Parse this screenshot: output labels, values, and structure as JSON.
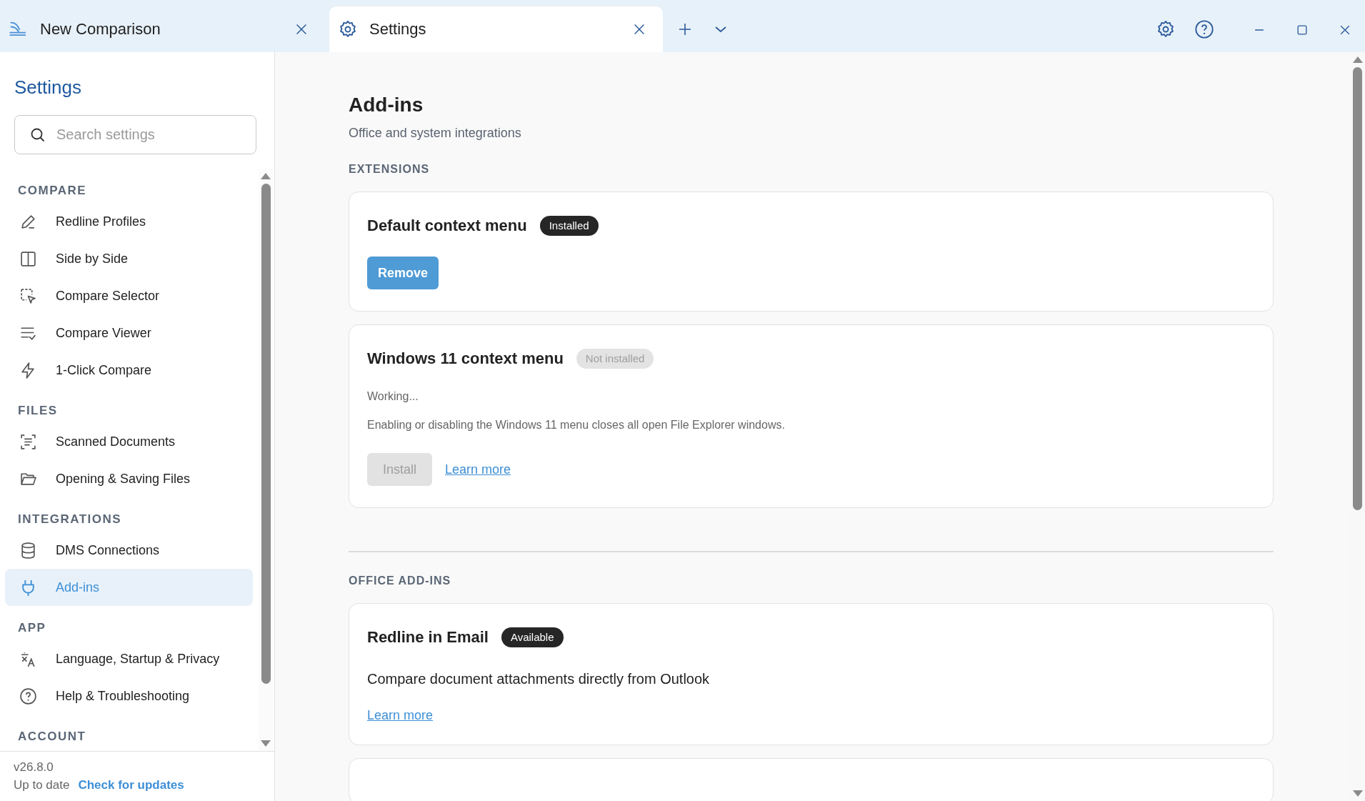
{
  "tabs": [
    {
      "label": "New Comparison",
      "kind": "logo",
      "selected": false
    },
    {
      "label": "Settings",
      "kind": "gear",
      "selected": true
    }
  ],
  "sidebar": {
    "title": "Settings",
    "search": {
      "placeholder": "Search settings"
    },
    "sections": [
      {
        "heading": "COMPARE",
        "items": [
          {
            "label": "Redline Profiles",
            "kind": "pen",
            "selected": false
          },
          {
            "label": "Side by Side",
            "kind": "columns",
            "selected": false
          },
          {
            "label": "Compare Selector",
            "kind": "select",
            "selected": false
          },
          {
            "label": "Compare Viewer",
            "kind": "listcheck",
            "selected": false
          },
          {
            "label": "1-Click Compare",
            "kind": "bolt",
            "selected": false
          }
        ]
      },
      {
        "heading": "FILES",
        "items": [
          {
            "label": "Scanned Documents",
            "kind": "scan",
            "selected": false
          },
          {
            "label": "Opening & Saving Files",
            "kind": "folder",
            "selected": false
          }
        ]
      },
      {
        "heading": "INTEGRATIONS",
        "items": [
          {
            "label": "DMS Connections",
            "kind": "database",
            "selected": false
          },
          {
            "label": "Add-ins",
            "kind": "plug",
            "selected": true
          }
        ]
      },
      {
        "heading": "APP",
        "items": [
          {
            "label": "Language, Startup & Privacy",
            "kind": "translate",
            "selected": false
          },
          {
            "label": "Help & Troubleshooting",
            "kind": "help",
            "selected": false
          }
        ]
      },
      {
        "heading": "ACCOUNT"
      }
    ],
    "version": "v26.8.0",
    "update_status": "Up to date",
    "update_link": "Check for updates"
  },
  "main": {
    "title": "Add-ins",
    "subtitle": "Office and system integrations",
    "sections": [
      {
        "heading": "EXTENSIONS",
        "cards": [
          {
            "kind": "full",
            "title": "Default context menu",
            "badge": {
              "text": "Installed",
              "kind": "active"
            },
            "button": {
              "label": "Remove",
              "disabled": false
            }
          },
          {
            "kind": "full",
            "title": "Windows 11 context menu",
            "badge": {
              "text": "Not installed",
              "kind": "inactive"
            },
            "status": "Working...",
            "note": "Enabling or disabling the Windows 11 menu closes all open File Explorer windows.",
            "button": {
              "label": "Install",
              "disabled": true
            },
            "link": "Learn more"
          }
        ]
      },
      {
        "heading": "OFFICE ADD-INS",
        "cards": [
          {
            "kind": "full",
            "title": "Redline in Email",
            "badge": {
              "text": "Available",
              "kind": "active"
            },
            "description": "Compare document attachments directly from Outlook",
            "link": "Learn more"
          },
          {
            "kind": "partial"
          }
        ]
      }
    ]
  }
}
